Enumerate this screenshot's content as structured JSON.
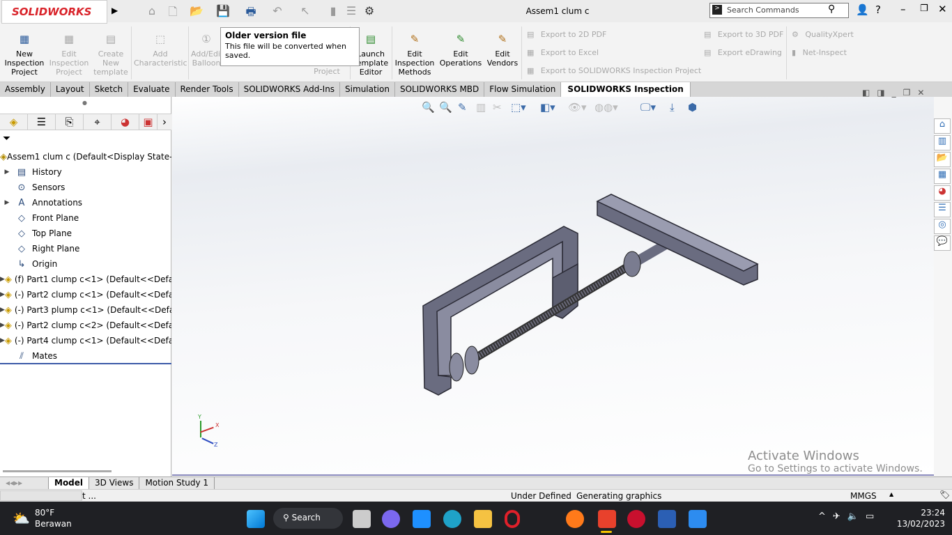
{
  "app": {
    "logo": "SOLIDWORKS",
    "title": "Assem1 clum c",
    "search_placeholder": "Search Commands"
  },
  "ribbon": {
    "buttons": [
      {
        "label": "New Inspection Project",
        "enabled": true
      },
      {
        "label": "Edit Inspection Project",
        "enabled": false
      },
      {
        "label": "Create New template",
        "enabled": false
      },
      {
        "label": "Add Characteristic",
        "enabled": false
      },
      {
        "label": "Add/Edit Balloon",
        "enabled": false
      },
      {
        "label": "Project",
        "enabled": false
      },
      {
        "label": "Launch Template Editor",
        "enabled": true
      },
      {
        "label": "Edit Inspection Methods",
        "enabled": true
      },
      {
        "label": "Edit Operations",
        "enabled": true
      },
      {
        "label": "Edit Vendors",
        "enabled": true
      }
    ],
    "small": [
      "Export to 2D PDF",
      "Export to Excel",
      "Export to SOLIDWORKS Inspection Project",
      "Export to 3D PDF",
      "Export eDrawing",
      "QualityXpert",
      "Net-Inspect"
    ]
  },
  "tooltip": {
    "title": "Older version file",
    "body": "This file will be converted when saved."
  },
  "tabs": [
    "Assembly",
    "Layout",
    "Sketch",
    "Evaluate",
    "Render Tools",
    "SOLIDWORKS Add-Ins",
    "Simulation",
    "SOLIDWORKS MBD",
    "Flow Simulation",
    "SOLIDWORKS Inspection"
  ],
  "active_tab": "SOLIDWORKS Inspection",
  "tree": {
    "root": "Assem1 clum c  (Default<Display State-1>",
    "items": [
      {
        "label": "History",
        "expand": true,
        "icon": "history-icon"
      },
      {
        "label": "Sensors",
        "expand": false,
        "icon": "sensor-icon"
      },
      {
        "label": "Annotations",
        "expand": true,
        "icon": "annotation-icon"
      },
      {
        "label": "Front Plane",
        "expand": false,
        "icon": "plane-icon"
      },
      {
        "label": "Top Plane",
        "expand": false,
        "icon": "plane-icon"
      },
      {
        "label": "Right Plane",
        "expand": false,
        "icon": "plane-icon"
      },
      {
        "label": "Origin",
        "expand": false,
        "icon": "origin-icon"
      },
      {
        "label": "(f) Part1 clump c<1> (Default<<Defa",
        "expand": true,
        "icon": "part-icon"
      },
      {
        "label": "(-) Part2 clump c<1> (Default<<Defa",
        "expand": true,
        "icon": "part-icon"
      },
      {
        "label": "(-) Part3 plump c<1> (Default<<Defa",
        "expand": true,
        "icon": "part-icon"
      },
      {
        "label": "(-) Part2 clump c<2> (Default<<Defa",
        "expand": true,
        "icon": "part-icon"
      },
      {
        "label": "(-) Part4 clump c<1> (Default<<Defa",
        "expand": true,
        "icon": "part-icon"
      },
      {
        "label": "Mates",
        "expand": false,
        "icon": "mates-icon"
      }
    ]
  },
  "bottom_tabs": [
    "Model",
    "3D Views",
    "Motion Study 1"
  ],
  "status": {
    "left": "t ...",
    "state": "Under Defined",
    "message": "Generating graphics",
    "units": "MMGS"
  },
  "watermark": {
    "title": "Activate Windows",
    "body": "Go to Settings to activate Windows."
  },
  "axes": {
    "x": "X",
    "y": "Y",
    "z": "Z"
  },
  "taskbar": {
    "weather_temp": "80°F",
    "weather_desc": "Berawan",
    "search": "Search",
    "time": "23:24",
    "date": "13/02/2023"
  }
}
